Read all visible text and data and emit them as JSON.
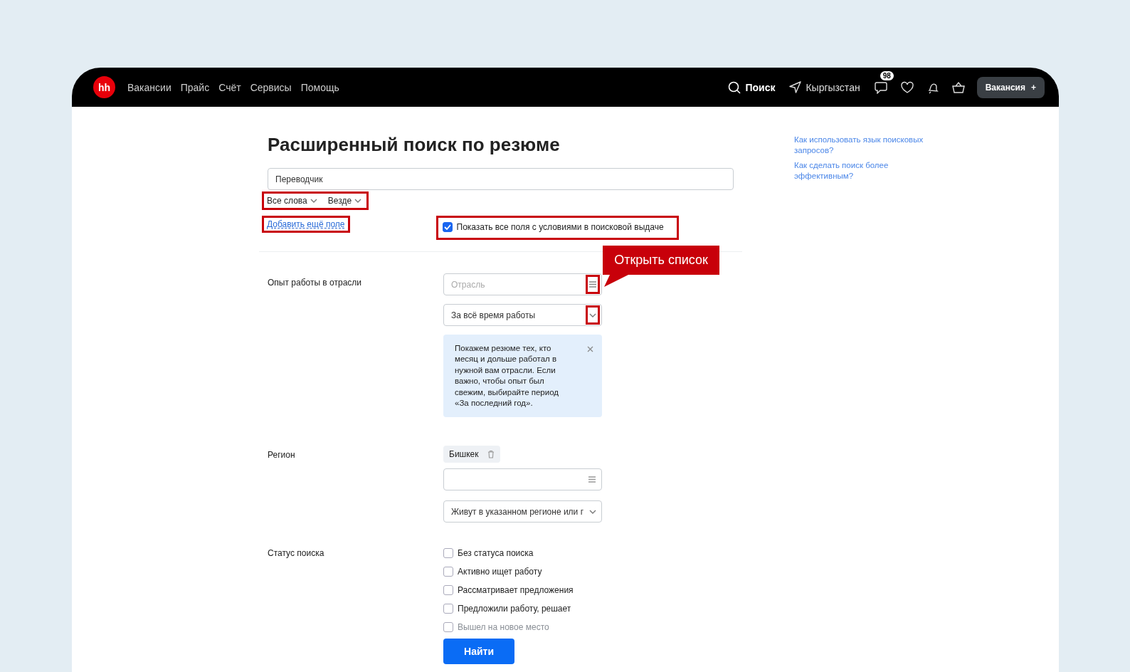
{
  "nav": {
    "logo": "hh",
    "links": [
      "Вакансии",
      "Прайс",
      "Счёт",
      "Сервисы",
      "Помощь"
    ],
    "search": "Поиск",
    "region": "Кыргызстан",
    "chat_badge": "98",
    "post_button": "Вакансия",
    "post_button_icon": "+"
  },
  "title": "Расширенный поиск по резюме",
  "query": {
    "value": "Переводчик"
  },
  "query_options": {
    "highlighted": true,
    "items": [
      "Все слова",
      "Везде"
    ]
  },
  "add_field": {
    "label": "Добавить ещё поле",
    "highlighted": true
  },
  "show_all": {
    "label": "Показать все поля с условиями в поисковой выдаче",
    "checked": true,
    "highlighted": true
  },
  "callout": "Открыть список",
  "experience": {
    "label": "Опыт работы в отрасли",
    "industry": {
      "placeholder": "Отрасль",
      "icon_highlighted": true
    },
    "period": {
      "value": "За всё время работы",
      "icon_highlighted": true
    },
    "info": "Покажем резюме тех, кто месяц и дольше работал в нужной вам отрасли. Если важно, чтобы опыт был свежим, выбирайте период «За последний год»."
  },
  "region": {
    "label": "Регион",
    "chips": [
      "Бишкек"
    ],
    "select": "Живут в указанном регионе или г"
  },
  "status": {
    "label": "Статус поиска",
    "options": [
      {
        "label": "Без статуса поиска",
        "checked": false,
        "faded": false
      },
      {
        "label": "Активно ищет работу",
        "checked": false,
        "faded": false
      },
      {
        "label": "Рассматривает предложения",
        "checked": false,
        "faded": false
      },
      {
        "label": "Предложили работу, решает",
        "checked": false,
        "faded": false
      },
      {
        "label": "Вышел на новое место",
        "checked": false,
        "faded": true
      }
    ]
  },
  "submit": "Найти",
  "help_links": [
    "Как использовать язык поисковых запросов?",
    "Как сделать поиск более эффективным?"
  ]
}
